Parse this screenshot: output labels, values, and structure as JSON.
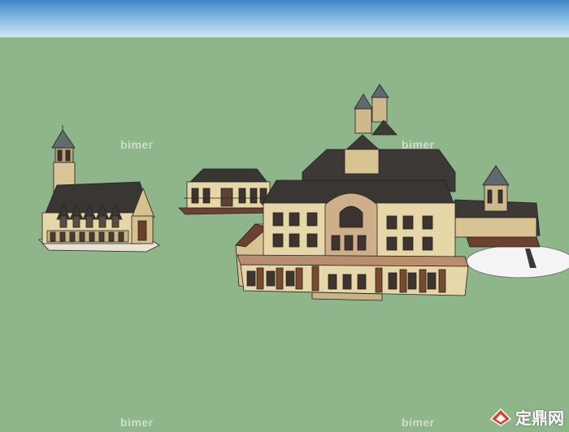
{
  "scene": {
    "sky_color": "#8ec0e6",
    "ground_color": "#8fb58a",
    "wall_color": "#e7d8ac",
    "roof_color": "#3f3a38",
    "trim_color": "#7a4a2e",
    "objects": [
      "church-model",
      "pavilion-model",
      "main-mansion-model",
      "round-plaza"
    ]
  },
  "watermarks": {
    "bimer_1": "bimer",
    "bimer_2": "bimer",
    "bimer_3": "bimer",
    "bimer_4": "bimer",
    "site_logo": "定鼎网"
  }
}
